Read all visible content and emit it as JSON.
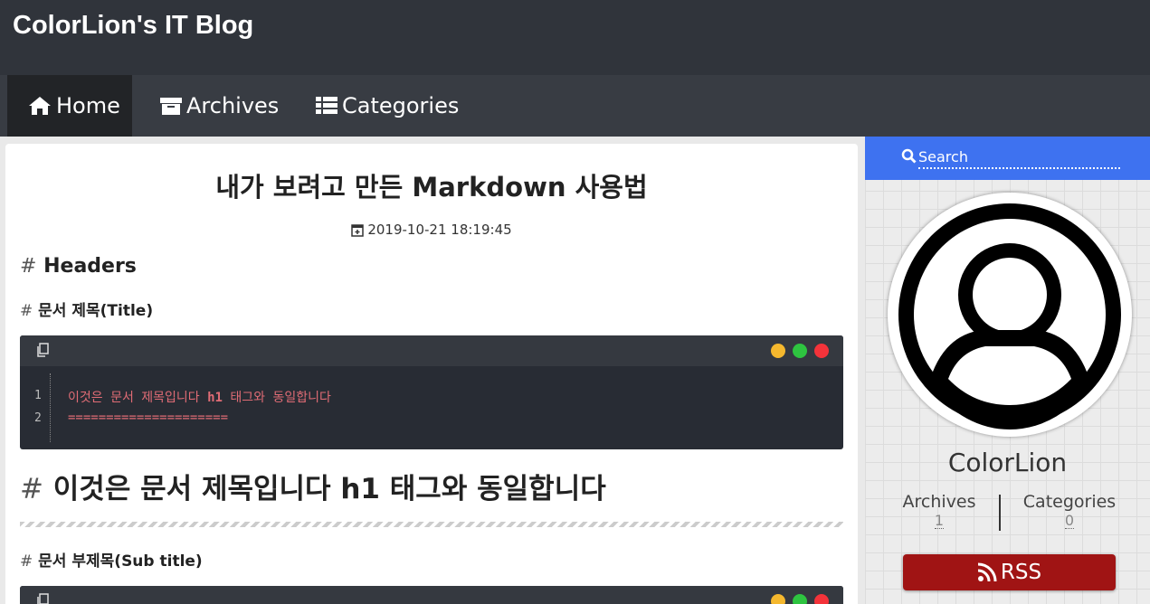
{
  "site": {
    "title": "ColorLion's IT Blog"
  },
  "nav": {
    "home": "Home",
    "archives": "Archives",
    "categories": "Categories"
  },
  "post": {
    "title": "내가 보려고 만든 Markdown 사용법",
    "date": "2019-10-21 18:19:45",
    "h_headers": "Headers",
    "h_title_label": "문서 제목",
    "h_title_suffix": "(Title)",
    "code1": {
      "line_numbers": [
        "1",
        "2"
      ],
      "line1_pre": "이것은 문서 제목입니다 ",
      "line1_tag": "h1",
      "line1_post": " 태그와 동일합니다",
      "line2": "====================="
    },
    "h1_example": "이것은 문서 제목입니다 h1 태그와 동일합니다",
    "h_sub_label": "문서 부제목",
    "h_sub_suffix": "(Sub title)",
    "hash": "#"
  },
  "sidebar": {
    "search_placeholder": "Search",
    "author": "ColorLion",
    "archives_label": "Archives",
    "archives_count": "1",
    "categories_label": "Categories",
    "categories_count": "0",
    "rss": "RSS"
  },
  "colors": {
    "accent": "#3e72f0",
    "rss": "#a01414",
    "header": "#30343b",
    "nav": "#383c43",
    "code_bg": "#282c34",
    "dot_yellow": "#f5b82e",
    "dot_green": "#2ec440",
    "dot_red": "#f4333a"
  }
}
